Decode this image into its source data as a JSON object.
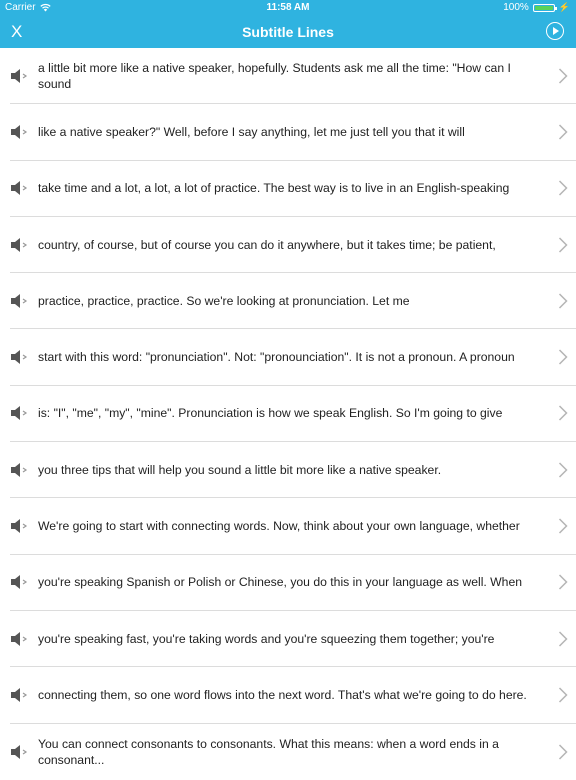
{
  "status_bar": {
    "carrier": "Carrier",
    "time": "11:58 AM",
    "battery": "100%",
    "wifi_icon": "wifi-icon",
    "battery_level": 1.0
  },
  "nav": {
    "close_label": "X",
    "title": "Subtitle Lines",
    "play_icon": "play-circle-icon"
  },
  "colors": {
    "nav_background": "#2fb3e0",
    "divider": "#dcdcdc",
    "battery_fill": "#59d35a"
  },
  "subtitle_lines": [
    {
      "text": "a little bit more like a native speaker, hopefully. Students ask me all the time: \"How can I sound"
    },
    {
      "text": "like a native speaker?\" Well, before I say anything, let me just tell you that it will"
    },
    {
      "text": "take time and a lot, a lot, a lot of practice. The best way is to live in an English-speaking"
    },
    {
      "text": "country, of course, but of course you can do it anywhere, but it takes time; be patient,"
    },
    {
      "text": "practice, practice, practice. So we're looking at pronunciation. Let me"
    },
    {
      "text": "start with this word: \"pronunciation\". Not: \"pronounciation\". It is not a pronoun. A pronoun"
    },
    {
      "text": "is: \"I\", \"me\", \"my\", \"mine\". Pronunciation is how we speak English. So I'm going to give"
    },
    {
      "text": "you three tips that will help you sound a little bit more like a native speaker."
    },
    {
      "text": "We're going to start with connecting words. Now, think about your own language, whether"
    },
    {
      "text": "you're speaking Spanish or Polish or Chinese, you do this in your language as well. When"
    },
    {
      "text": "you're speaking fast, you're taking words and you're squeezing them together; you're"
    },
    {
      "text": "connecting them, so one word flows into the next word. That's what we're going to do here."
    },
    {
      "text": "You can connect consonants to consonants. What this means: when a word ends in a consonant..."
    }
  ]
}
